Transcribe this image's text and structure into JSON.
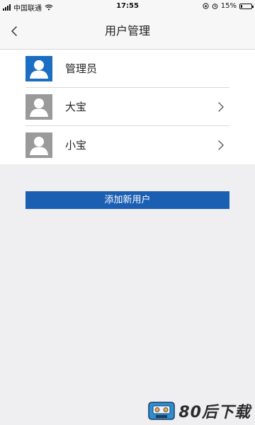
{
  "status_bar": {
    "carrier": "中国联通",
    "time": "17:55",
    "battery_percent": "15%",
    "battery_level": 0.15
  },
  "nav": {
    "title": "用户管理"
  },
  "users": [
    {
      "name": "管理员",
      "avatar_color": "#1b6ec2",
      "has_chevron": false
    },
    {
      "name": "大宝",
      "avatar_color": "#9a9a9a",
      "has_chevron": true
    },
    {
      "name": "小宝",
      "avatar_color": "#9a9a9a",
      "has_chevron": true
    }
  ],
  "actions": {
    "add_user_label": "添加新用户"
  },
  "watermark": {
    "text": "80后下载"
  },
  "colors": {
    "accent": "#1b5fb3",
    "background": "#efeef0",
    "list_background": "#ffffff"
  }
}
